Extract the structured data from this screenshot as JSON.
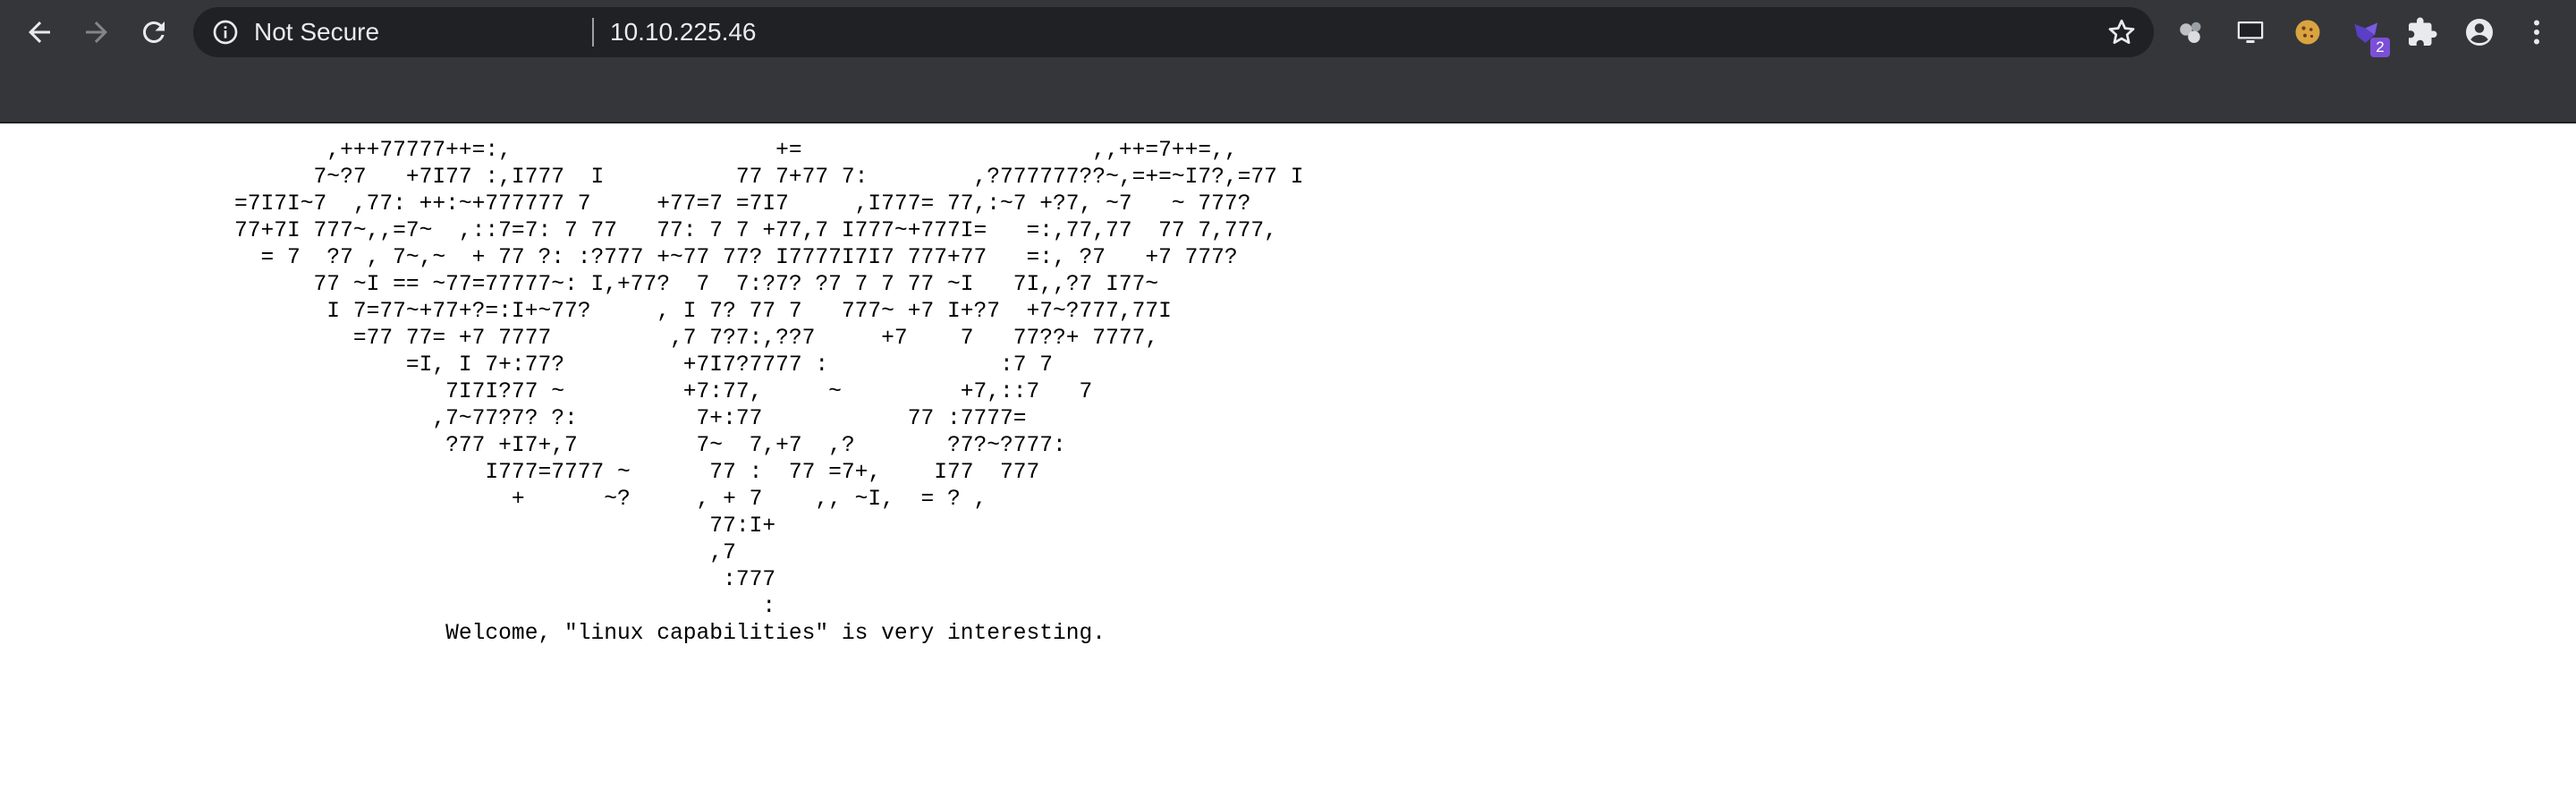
{
  "browser": {
    "security_label": "Not Secure",
    "url": "10.10.225.46",
    "icons": {
      "back": "arrow-left-icon",
      "forward": "arrow-right-icon",
      "reload": "reload-icon",
      "info": "info-icon",
      "bookmark": "star-icon",
      "extensions": [
        "wappalyzer-icon",
        "monitor-icon",
        "cookie-icon",
        "foxyproxy-icon",
        "puzzle-icon"
      ],
      "profile": "account-icon",
      "menu": "kebab-menu-icon"
    },
    "extension_badge": "2",
    "colors": {
      "toolbar": "#35363a",
      "omnibox": "#202124",
      "badge": "#7b4fd6"
    }
  },
  "page": {
    "ascii_art": "       ,+++77777++=:,                    +=                      ,,++=7++=,,\n      7~?7   +7I77 :,I777  I          77 7+77 7:        ,?777777??~,=+=~I7?,=77 I\n=7I7I~7  ,77: ++:~+777777 7     +77=7 =7I7     ,I777= 77,:~7 +?7, ~7   ~ 777?\n77+7I 777~,,=7~  ,::7=7: 7 77   77: 7 7 +77,7 I777~+777I=   =:,77,77  77 7,777,\n  = 7  ?7 , 7~,~  + 77 ?: :?777 +~77 77? I7777I7I7 777+77   =:, ?7   +7 777?\n      77 ~I == ~77=77777~: I,+77?  7  7:?7? ?7 7 7 77 ~I   7I,,?7 I77~\n       I 7=77~+77+?=:I+~77?     , I 7? 77 7   777~ +7 I+?7  +7~?777,77I\n         =77 77= +7 7777         ,7 7?7:,??7     +7    7   77??+ 7777,\n             =I, I 7+:77?         +7I7?7777 :             :7 7\n                7I7I?77 ~         +7:77,     ~         +7,::7   7\n               ,7~77?7? ?:         7+:77           77 :7777=\n                ?77 +I7+,7         7~  7,+7  ,?       ?7?~?777:\n                   I777=7777 ~      77 :  77 =7+,    I77  777\n                     +      ~?     , + 7    ,, ~I,  = ? ,\n                                    77:I+\n                                    ,7\n                                     :777\n                                        :\n                Welcome, \"linux capabilities\" is very interesting."
  }
}
